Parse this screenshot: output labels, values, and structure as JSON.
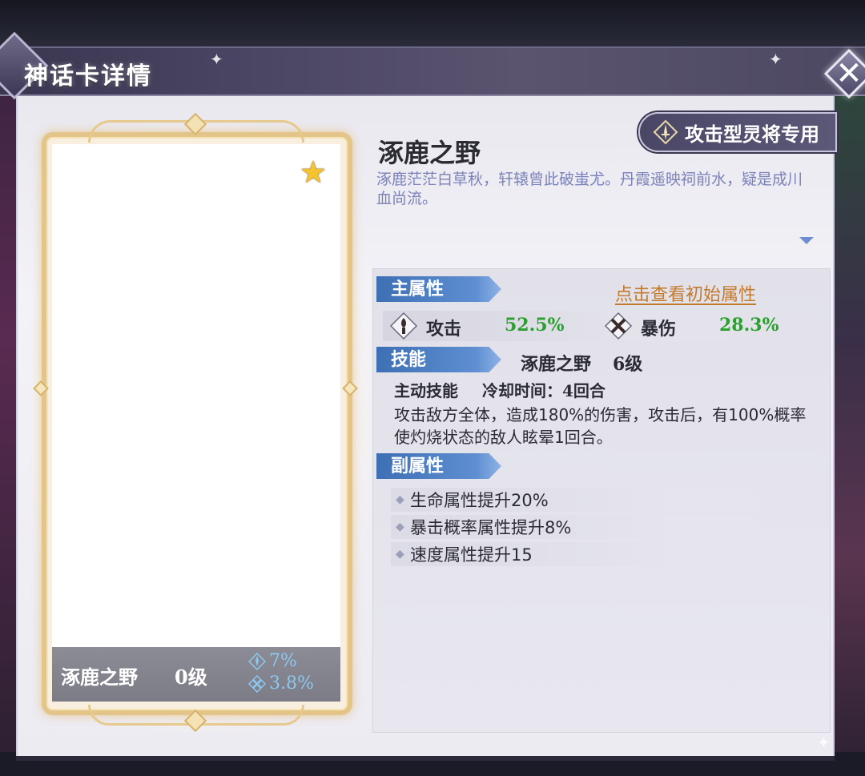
{
  "window": {
    "title": "神话卡详情",
    "close_label": "✕"
  },
  "card": {
    "name": "涿鹿之野",
    "level": "0级",
    "star_icon": "star-icon",
    "stats": [
      {
        "icon": "attack-icon",
        "value": "7%"
      },
      {
        "icon": "crit-damage-icon",
        "value": "3.8%"
      }
    ]
  },
  "item": {
    "title": "涿鹿之野",
    "description": "涿鹿茫茫白草秋，轩辕曾此破蚩尤。丹霞遥映祠前水，疑是成川血尚流。",
    "type_badge": "攻击型灵将专用"
  },
  "main_attr": {
    "section_label": "主属性",
    "view_initial_label": "点击查看初始属性",
    "stats": [
      {
        "icon": "attack-icon",
        "label": "攻击",
        "value": "52.5%"
      },
      {
        "icon": "crit-damage-icon",
        "label": "暴伤",
        "value": "28.3%"
      }
    ]
  },
  "skill": {
    "section_label": "技能",
    "name": "涿鹿之野",
    "level": "6级",
    "type": "主动技能",
    "cooldown": "冷却时间：4回合",
    "description": "攻击敌方全体，造成180%的伤害，攻击后，有100%概率使灼烧状态的敌人眩晕1回合。"
  },
  "sub_attr": {
    "section_label": "副属性",
    "items": [
      "生命属性提升20%",
      "暴击概率属性提升8%",
      "速度属性提升15"
    ]
  },
  "colors": {
    "accent_blue": "#4f82c6",
    "value_green": "#2aa02e",
    "link_orange": "#c47a2c",
    "desc_purple": "#7a82b8"
  }
}
